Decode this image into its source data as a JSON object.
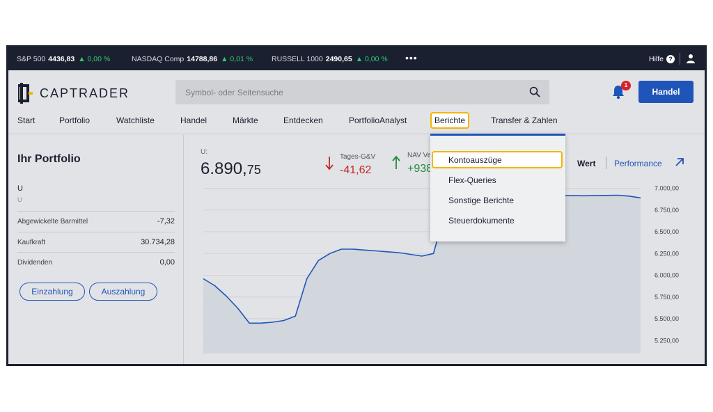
{
  "ticker": {
    "items": [
      {
        "name": "S&P 500",
        "value": "4436,83",
        "change": "▲ 0,00 %"
      },
      {
        "name": "NASDAQ Comp",
        "value": "14788,86",
        "change": "▲ 0,01 %"
      },
      {
        "name": "RUSSELL 1000",
        "value": "2490,65",
        "change": "▲ 0,00 %"
      }
    ],
    "more": "•••",
    "help_label": "Hilfe",
    "help_icon_text": "?"
  },
  "header": {
    "brand": "CAPTRADER",
    "search_placeholder": "Symbol- oder Seitensuche",
    "notification_count": "1",
    "trade_button": "Handel"
  },
  "nav": {
    "items": [
      "Start",
      "Portfolio",
      "Watchliste",
      "Handel",
      "Märkte",
      "Entdecken",
      "PortfolioAnalyst",
      "Berichte",
      "Transfer & Zahlen"
    ]
  },
  "dropdown": {
    "items": [
      "Kontoauszüge",
      "Flex-Queries",
      "Sonstige Berichte",
      "Steuerdokumente"
    ]
  },
  "portfolio": {
    "title": "Ihr Portfolio",
    "account": "U",
    "account_sub": "U",
    "rows": [
      {
        "label": "Abgewickelte Barmittel",
        "value": "-7,32"
      },
      {
        "label": "Kaufkraft",
        "value": "30.734,28"
      },
      {
        "label": "Dividenden",
        "value": "0,00"
      }
    ],
    "deposit_button": "Einzahlung",
    "withdraw_button": "Auszahlung"
  },
  "summary": {
    "account_label": "U:",
    "value_main": "6.890,",
    "value_dec": "75",
    "pl_label": "Tages-G&V",
    "pl_value": "-41,62",
    "nav_label": "NAV Ve",
    "nav_value": "+938",
    "view_wert": "Wert",
    "view_performance": "Performance"
  },
  "chart_data": {
    "type": "area",
    "ylim": [
      5100,
      7100
    ],
    "yticks": [
      "7.000,00",
      "6.750,00",
      "6.500,00",
      "6.250,00",
      "6.000,00",
      "5.750,00",
      "5.500,00",
      "5.250,00"
    ],
    "ytick_values": [
      7000,
      6750,
      6500,
      6250,
      6000,
      5750,
      5500,
      5250
    ],
    "values": [
      5960,
      5880,
      5760,
      5620,
      5450,
      5450,
      5460,
      5480,
      5530,
      5960,
      6170,
      6250,
      6300,
      6300,
      6290,
      6280,
      6270,
      6260,
      6240,
      6220,
      6250,
      6720,
      6830,
      6900,
      6920,
      6935,
      6940,
      6930,
      6925,
      6920,
      6918,
      6916,
      6915,
      6914,
      6915,
      6918,
      6920,
      6910,
      6890
    ],
    "colors": {
      "line": "#1f55b8",
      "fill": "#d0d4dc"
    }
  }
}
